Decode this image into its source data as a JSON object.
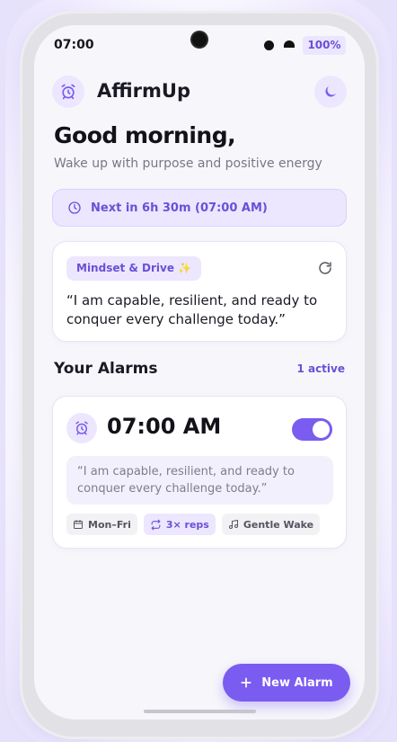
{
  "status_bar": {
    "time": "07:00",
    "battery": "100%"
  },
  "header": {
    "app_icon": "alarm-clock-icon",
    "title": "AffirmUp",
    "theme_icon": "moon-icon"
  },
  "greeting": {
    "title": "Good morning,",
    "subtitle": "Wake up with purpose and positive energy"
  },
  "next_alarm": {
    "icon": "clock-icon",
    "text": "Next in 6h 30m (07:00 AM)"
  },
  "affirmation": {
    "category": "Mindset & Drive ✨",
    "refresh_icon": "refresh-icon",
    "text": "“I am capable, resilient, and ready to conquer every challenge today.”"
  },
  "alarms_section": {
    "title": "Your Alarms",
    "active_count": "1 active"
  },
  "alarms": [
    {
      "icon": "alarm-clock-icon",
      "time": "07:00 AM",
      "enabled": true,
      "quote": "“I am capable, resilient, and ready to conquer every challenge today.”",
      "tags": [
        {
          "icon": "calendar-icon",
          "label": "Mon–Fri"
        },
        {
          "icon": "repeat-icon",
          "label": "3× reps"
        },
        {
          "icon": "music-note-icon",
          "label": "Gentle Wake"
        }
      ]
    }
  ],
  "fab": {
    "icon": "plus-icon",
    "label": "New Alarm"
  },
  "colors": {
    "accent": "#7a5cf0",
    "accent_text": "#6b4fd8",
    "accent_soft": "#ece7fe"
  }
}
